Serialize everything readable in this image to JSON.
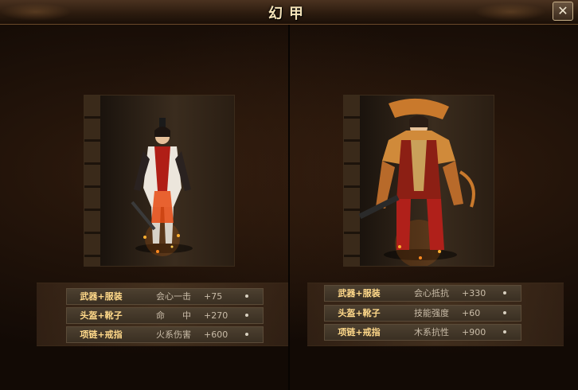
{
  "window": {
    "title": "幻甲",
    "close_symbol": "✕"
  },
  "sets": [
    {
      "rows": [
        {
          "parts": "武器+服装",
          "stat": "会心一击",
          "value": "+75"
        },
        {
          "parts": "头盔+靴子",
          "stat": "命　　中",
          "value": "+270"
        },
        {
          "parts": "项链+戒指",
          "stat": "火系伤害",
          "value": "+600"
        }
      ]
    },
    {
      "rows": [
        {
          "parts": "武器+服装",
          "stat": "会心抵抗",
          "value": "+330"
        },
        {
          "parts": "头盔+靴子",
          "stat": "技能强度",
          "value": "+60"
        },
        {
          "parts": "项链+戒指",
          "stat": "木系抗性",
          "value": "+900"
        }
      ]
    }
  ],
  "colors": {
    "accent": "#ffd98a",
    "frame": "#c9b18a"
  }
}
